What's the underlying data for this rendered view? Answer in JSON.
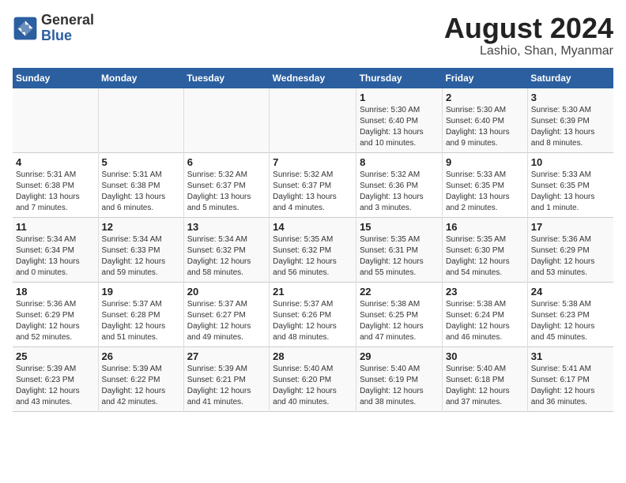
{
  "header": {
    "logo_general": "General",
    "logo_blue": "Blue",
    "month_year": "August 2024",
    "location": "Lashio, Shan, Myanmar"
  },
  "days_of_week": [
    "Sunday",
    "Monday",
    "Tuesday",
    "Wednesday",
    "Thursday",
    "Friday",
    "Saturday"
  ],
  "weeks": [
    [
      {
        "day": "",
        "info": ""
      },
      {
        "day": "",
        "info": ""
      },
      {
        "day": "",
        "info": ""
      },
      {
        "day": "",
        "info": ""
      },
      {
        "day": "1",
        "info": "Sunrise: 5:30 AM\nSunset: 6:40 PM\nDaylight: 13 hours\nand 10 minutes."
      },
      {
        "day": "2",
        "info": "Sunrise: 5:30 AM\nSunset: 6:40 PM\nDaylight: 13 hours\nand 9 minutes."
      },
      {
        "day": "3",
        "info": "Sunrise: 5:30 AM\nSunset: 6:39 PM\nDaylight: 13 hours\nand 8 minutes."
      }
    ],
    [
      {
        "day": "4",
        "info": "Sunrise: 5:31 AM\nSunset: 6:38 PM\nDaylight: 13 hours\nand 7 minutes."
      },
      {
        "day": "5",
        "info": "Sunrise: 5:31 AM\nSunset: 6:38 PM\nDaylight: 13 hours\nand 6 minutes."
      },
      {
        "day": "6",
        "info": "Sunrise: 5:32 AM\nSunset: 6:37 PM\nDaylight: 13 hours\nand 5 minutes."
      },
      {
        "day": "7",
        "info": "Sunrise: 5:32 AM\nSunset: 6:37 PM\nDaylight: 13 hours\nand 4 minutes."
      },
      {
        "day": "8",
        "info": "Sunrise: 5:32 AM\nSunset: 6:36 PM\nDaylight: 13 hours\nand 3 minutes."
      },
      {
        "day": "9",
        "info": "Sunrise: 5:33 AM\nSunset: 6:35 PM\nDaylight: 13 hours\nand 2 minutes."
      },
      {
        "day": "10",
        "info": "Sunrise: 5:33 AM\nSunset: 6:35 PM\nDaylight: 13 hours\nand 1 minute."
      }
    ],
    [
      {
        "day": "11",
        "info": "Sunrise: 5:34 AM\nSunset: 6:34 PM\nDaylight: 13 hours\nand 0 minutes."
      },
      {
        "day": "12",
        "info": "Sunrise: 5:34 AM\nSunset: 6:33 PM\nDaylight: 12 hours\nand 59 minutes."
      },
      {
        "day": "13",
        "info": "Sunrise: 5:34 AM\nSunset: 6:32 PM\nDaylight: 12 hours\nand 58 minutes."
      },
      {
        "day": "14",
        "info": "Sunrise: 5:35 AM\nSunset: 6:32 PM\nDaylight: 12 hours\nand 56 minutes."
      },
      {
        "day": "15",
        "info": "Sunrise: 5:35 AM\nSunset: 6:31 PM\nDaylight: 12 hours\nand 55 minutes."
      },
      {
        "day": "16",
        "info": "Sunrise: 5:35 AM\nSunset: 6:30 PM\nDaylight: 12 hours\nand 54 minutes."
      },
      {
        "day": "17",
        "info": "Sunrise: 5:36 AM\nSunset: 6:29 PM\nDaylight: 12 hours\nand 53 minutes."
      }
    ],
    [
      {
        "day": "18",
        "info": "Sunrise: 5:36 AM\nSunset: 6:29 PM\nDaylight: 12 hours\nand 52 minutes."
      },
      {
        "day": "19",
        "info": "Sunrise: 5:37 AM\nSunset: 6:28 PM\nDaylight: 12 hours\nand 51 minutes."
      },
      {
        "day": "20",
        "info": "Sunrise: 5:37 AM\nSunset: 6:27 PM\nDaylight: 12 hours\nand 49 minutes."
      },
      {
        "day": "21",
        "info": "Sunrise: 5:37 AM\nSunset: 6:26 PM\nDaylight: 12 hours\nand 48 minutes."
      },
      {
        "day": "22",
        "info": "Sunrise: 5:38 AM\nSunset: 6:25 PM\nDaylight: 12 hours\nand 47 minutes."
      },
      {
        "day": "23",
        "info": "Sunrise: 5:38 AM\nSunset: 6:24 PM\nDaylight: 12 hours\nand 46 minutes."
      },
      {
        "day": "24",
        "info": "Sunrise: 5:38 AM\nSunset: 6:23 PM\nDaylight: 12 hours\nand 45 minutes."
      }
    ],
    [
      {
        "day": "25",
        "info": "Sunrise: 5:39 AM\nSunset: 6:23 PM\nDaylight: 12 hours\nand 43 minutes."
      },
      {
        "day": "26",
        "info": "Sunrise: 5:39 AM\nSunset: 6:22 PM\nDaylight: 12 hours\nand 42 minutes."
      },
      {
        "day": "27",
        "info": "Sunrise: 5:39 AM\nSunset: 6:21 PM\nDaylight: 12 hours\nand 41 minutes."
      },
      {
        "day": "28",
        "info": "Sunrise: 5:40 AM\nSunset: 6:20 PM\nDaylight: 12 hours\nand 40 minutes."
      },
      {
        "day": "29",
        "info": "Sunrise: 5:40 AM\nSunset: 6:19 PM\nDaylight: 12 hours\nand 38 minutes."
      },
      {
        "day": "30",
        "info": "Sunrise: 5:40 AM\nSunset: 6:18 PM\nDaylight: 12 hours\nand 37 minutes."
      },
      {
        "day": "31",
        "info": "Sunrise: 5:41 AM\nSunset: 6:17 PM\nDaylight: 12 hours\nand 36 minutes."
      }
    ]
  ]
}
